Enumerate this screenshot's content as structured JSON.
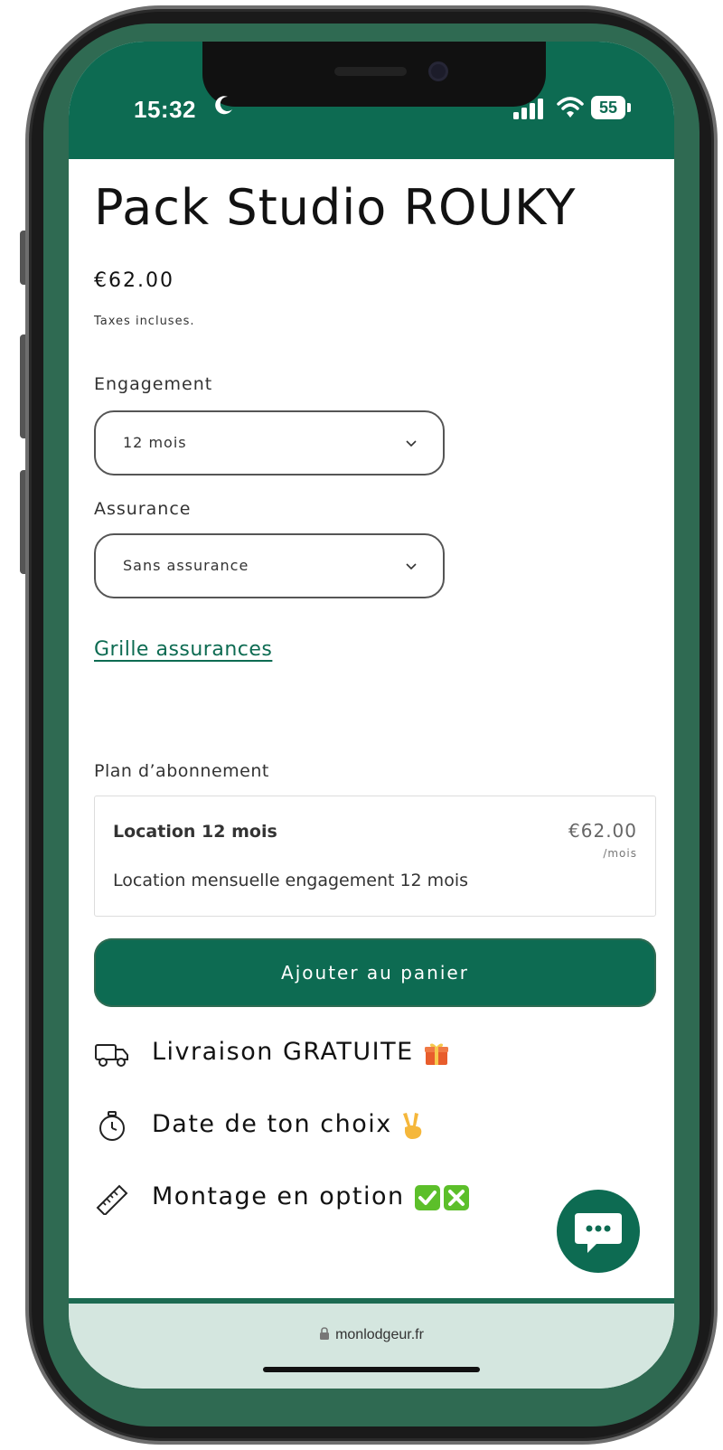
{
  "status": {
    "time": "15:32",
    "battery": "55"
  },
  "product": {
    "title": "Pack Studio ROUKY",
    "price": "€62.00",
    "tax_note": "Taxes incluses."
  },
  "options": {
    "engagement": {
      "label": "Engagement",
      "value": "12 mois"
    },
    "assurance": {
      "label": "Assurance",
      "value": "Sans assurance"
    }
  },
  "link": {
    "insurance_grid": "Grille assurances"
  },
  "plan": {
    "label": "Plan d’abonnement",
    "name": "Location 12 mois",
    "price": "€62.00",
    "unit": "/mois",
    "description": "Location mensuelle engagement 12 mois"
  },
  "cta": {
    "add_to_cart": "Ajouter au panier"
  },
  "features": [
    {
      "text": "Livraison GRATUITE",
      "icon": "truck-icon",
      "emoji": "gift-emoji"
    },
    {
      "text": "Date de ton choix",
      "icon": "stopwatch-icon",
      "emoji": "victory-hand-emoji"
    },
    {
      "text": "Montage en option",
      "icon": "ruler-icon",
      "emoji": "check-cross-emoji"
    }
  ],
  "browser": {
    "url": "monlodgeur.fr"
  },
  "colors": {
    "brand": "#0d6b52",
    "frame": "#2f6a52",
    "urlbar": "#d4e6df"
  }
}
